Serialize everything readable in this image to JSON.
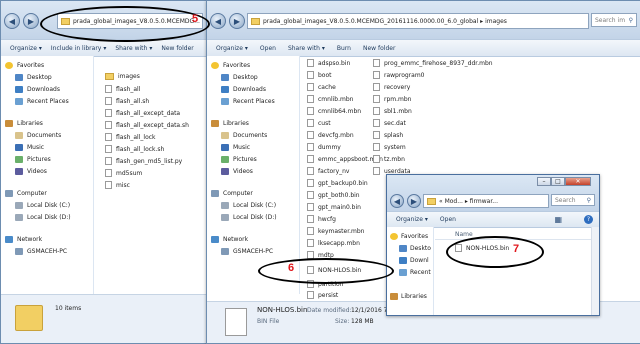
{
  "left_window": {
    "address": "prada_global_images_V8.0.5.0.MCEMDG...",
    "toolbar": [
      "Organize",
      "Include in library",
      "Share with",
      "New folder"
    ],
    "nav": {
      "favorites": "Favorites",
      "favorites_items": [
        "Desktop",
        "Downloads",
        "Recent Places"
      ],
      "libraries": "Libraries",
      "libraries_items": [
        "Documents",
        "Music",
        "Pictures",
        "Videos"
      ],
      "computer": "Computer",
      "computer_items": [
        "Local Disk (C:)",
        "Local Disk (D:)"
      ],
      "network": "Network",
      "network_items": [
        "GSMACEH-PC"
      ]
    },
    "files": [
      {
        "name": "images",
        "folder": true
      },
      {
        "name": "flash_all",
        "folder": false
      },
      {
        "name": "flash_all.sh",
        "folder": false
      },
      {
        "name": "flash_all_except_data",
        "folder": false
      },
      {
        "name": "flash_all_except_data.sh",
        "folder": false
      },
      {
        "name": "flash_all_lock",
        "folder": false
      },
      {
        "name": "flash_all_lock.sh",
        "folder": false
      },
      {
        "name": "flash_gen_md5_list.py",
        "folder": false
      },
      {
        "name": "md5sum",
        "folder": false
      },
      {
        "name": "misc",
        "folder": false
      }
    ],
    "status": "10 items"
  },
  "middle_window": {
    "address": "prada_global_images_V8.0.5.0.MCEMDG_20161116.0000.00_6.0_global ▸ images",
    "search_placeholder": "Search im",
    "toolbar": [
      "Organize",
      "Open",
      "Share with",
      "Burn",
      "New folder"
    ],
    "nav": {
      "favorites": "Favorites",
      "favorites_items": [
        "Desktop",
        "Downloads",
        "Recent Places"
      ],
      "libraries": "Libraries",
      "libraries_items": [
        "Documents",
        "Music",
        "Pictures",
        "Videos"
      ],
      "computer": "Computer",
      "computer_items": [
        "Local Disk (C:)",
        "Local Disk (D:)"
      ],
      "network": "Network",
      "network_items": [
        "GSMACEH-PC"
      ]
    },
    "files_col1": [
      "adspso.bin",
      "boot",
      "cache",
      "cmnlib.mbn",
      "cmnlib64.mbn",
      "cust",
      "devcfg.mbn",
      "dummy",
      "emmc_appsboot.mbn",
      "factory_nv",
      "gpt_backup0.bin",
      "gpt_both0.bin",
      "gpt_main0.bin",
      "hwcfg",
      "keymaster.mbn",
      "lksecapp.mbn",
      "mdtp",
      "NON-HLOS.bin",
      "partition",
      "persist"
    ],
    "files_col2": [
      "prog_emmc_firehose_8937_ddr.mbn",
      "rawprogram0",
      "recovery",
      "rpm.mbn",
      "sbl1.mbn",
      "sec.dat",
      "splash",
      "system",
      "tz.mbn",
      "userdata"
    ],
    "details": {
      "name": "NON-HLOS.bin",
      "modified_label": "Date modified:",
      "modified": "12/1/2016 7:04 PM",
      "type": "BIN File",
      "size_label": "Size:",
      "size": "128 MB"
    }
  },
  "small_window": {
    "address": "« Mod... ▸ firmwar...",
    "search_placeholder": "Search",
    "toolbar": [
      "Organize",
      "Open"
    ],
    "column_header": "Name",
    "nav_items": [
      "Favorites",
      "Deskto",
      "Downl",
      "Recent",
      "Libraries"
    ],
    "file": "NON-HLOS.bin"
  },
  "annotations": {
    "label_5": "5",
    "label_6": "6",
    "label_7": "7",
    "color": "#e0161b"
  }
}
